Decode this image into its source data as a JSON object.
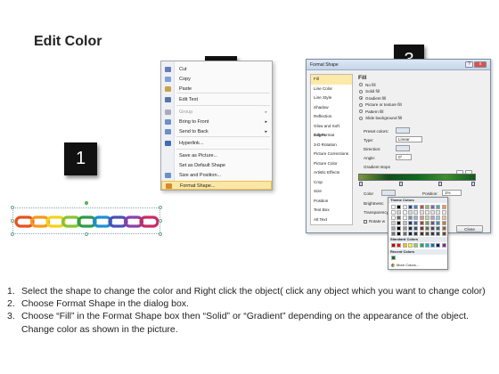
{
  "title": "Edit Color",
  "callouts": {
    "one": "1",
    "two": "2",
    "three": "3"
  },
  "chain_colors": [
    "#e8501f",
    "#f39a1a",
    "#f4d21d",
    "#86c332",
    "#2c9c48",
    "#1d8fd4",
    "#4a4fb7",
    "#8b3fa8",
    "#c72c63"
  ],
  "context_menu": {
    "items": [
      {
        "label": "Cut",
        "icon": "scissors-icon",
        "icon_color": "#6a7bbd",
        "disabled": false,
        "submenu": false
      },
      {
        "label": "Copy",
        "icon": "copy-icon",
        "icon_color": "#7fa1d6",
        "disabled": false,
        "submenu": false
      },
      {
        "label": "Paste",
        "icon": "paste-icon",
        "icon_color": "#c9a24a",
        "disabled": false,
        "submenu": false
      },
      {
        "label": "Edit Text",
        "icon": "edit-text-icon",
        "icon_color": "#5577aa",
        "disabled": false,
        "submenu": false
      },
      {
        "label": "Group",
        "icon": "group-icon",
        "icon_color": "#aab",
        "disabled": true,
        "submenu": true
      },
      {
        "label": "Bring to Front",
        "icon": "bring-front-icon",
        "icon_color": "#6c8fc8",
        "disabled": false,
        "submenu": true
      },
      {
        "label": "Send to Back",
        "icon": "send-back-icon",
        "icon_color": "#6c8fc8",
        "disabled": false,
        "submenu": true
      },
      {
        "label": "Hyperlink...",
        "icon": "hyperlink-icon",
        "icon_color": "#3d6db3",
        "disabled": false,
        "submenu": false
      },
      {
        "label": "Save as Picture...",
        "icon": "",
        "icon_color": "",
        "disabled": false,
        "submenu": false
      },
      {
        "label": "Set as Default Shape",
        "icon": "",
        "icon_color": "",
        "disabled": false,
        "submenu": false
      },
      {
        "label": "Size and Position...",
        "icon": "size-position-icon",
        "icon_color": "#6c8fc8",
        "disabled": false,
        "submenu": false
      },
      {
        "label": "Format Shape...",
        "icon": "format-shape-icon",
        "icon_color": "#d88a2a",
        "disabled": false,
        "submenu": false,
        "highlighted": true
      }
    ]
  },
  "dialog": {
    "title": "Format Shape",
    "categories": [
      "Fill",
      "Line Color",
      "Line Style",
      "Shadow",
      "Reflection",
      "Glow and Soft Edges",
      "3-D Format",
      "3-D Rotation",
      "Picture Corrections",
      "Picture Color",
      "Artistic Effects",
      "Crop",
      "Size",
      "Position",
      "Text Box",
      "Alt Text"
    ],
    "selected_category": "Fill",
    "section": "Fill",
    "fill_options": [
      "No fill",
      "Solid fill",
      "Gradient fill",
      "Picture or texture fill",
      "Pattern fill",
      "Slide background fill"
    ],
    "selected_fill": "Gradient fill",
    "preset_label": "Preset colors:",
    "type_label": "Type:",
    "type_value": "Linear",
    "direction_label": "Direction:",
    "angle_label": "Angle:",
    "angle_value": "0°",
    "stops_label": "Gradient stops",
    "color_label": "Color",
    "position_label": "Position:",
    "position_value": "1%",
    "brightness_label": "Brightness:",
    "transparency_label": "Transparency:",
    "rotate_label": "Rotate w",
    "close_label": "Close",
    "min_label": "?",
    "close_x": "x"
  },
  "color_popup": {
    "theme_header": "Theme Colors",
    "standard_header": "Standard Colors",
    "recent_header": "Recent Colors",
    "more_colors": "More Colors...",
    "theme_row": [
      "#ffffff",
      "#000000",
      "#eeece1",
      "#1f497d",
      "#4f81bd",
      "#c0504d",
      "#9bbb59",
      "#8064a2",
      "#4bacc6",
      "#f79646"
    ],
    "standard_row": [
      "#c00000",
      "#ff0000",
      "#ffc000",
      "#ffff00",
      "#92d050",
      "#00b050",
      "#00b0f0",
      "#0070c0",
      "#002060",
      "#7030a0"
    ],
    "recent_row": [
      "#1a6b2a"
    ]
  },
  "instructions": [
    {
      "n": "1.",
      "text": "Select the shape to change the color and Right click the object( click any object which you want to change color)"
    },
    {
      "n": "2.",
      "text": "Choose Format Shape in the dialog box."
    },
    {
      "n": "3.",
      "text": "Choose “Fill” in the Format Shape box then “Solid” or “Gradient” depending on the appearance of the object. Change color as shown in the picture."
    }
  ]
}
